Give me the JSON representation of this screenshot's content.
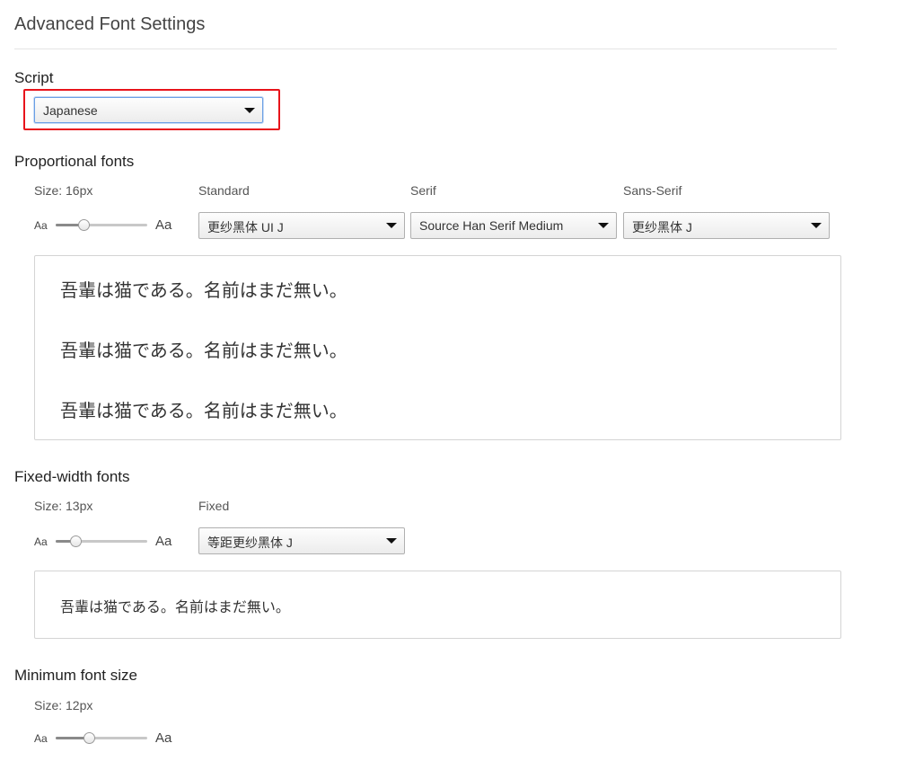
{
  "page": {
    "title": "Advanced Font Settings"
  },
  "script": {
    "label": "Script",
    "selected": "Japanese"
  },
  "proportional": {
    "heading": "Proportional fonts",
    "size_label": "Size: 16px",
    "slider": {
      "min_label": "Aa",
      "max_label": "Aa",
      "fraction": 0.28
    },
    "standard": {
      "label": "Standard",
      "selected": "更纱黑体 UI J"
    },
    "serif": {
      "label": "Serif",
      "selected": "Source Han Serif Medium"
    },
    "sans_serif": {
      "label": "Sans-Serif",
      "selected": "更纱黑体 J"
    },
    "samples": [
      "吾輩は猫である。名前はまだ無い。",
      "吾輩は猫である。名前はまだ無い。",
      "吾輩は猫である。名前はまだ無い。"
    ]
  },
  "fixed_width": {
    "heading": "Fixed-width fonts",
    "size_label": "Size: 13px",
    "slider": {
      "min_label": "Aa",
      "max_label": "Aa",
      "fraction": 0.18
    },
    "fixed": {
      "label": "Fixed",
      "selected": "等距更纱黑体 J"
    },
    "sample": "吾輩は猫である。名前はまだ無い。"
  },
  "minimum": {
    "heading": "Minimum font size",
    "size_label": "Size: 12px",
    "slider": {
      "min_label": "Aa",
      "max_label": "Aa",
      "fraction": 0.35
    }
  },
  "colors": {
    "highlight": "#e8141b",
    "focus_border": "#6a9fe4"
  }
}
